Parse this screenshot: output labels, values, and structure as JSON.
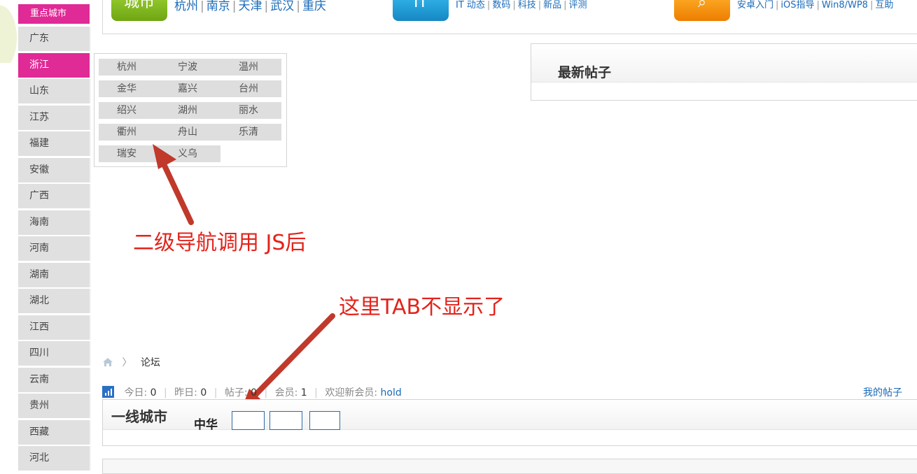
{
  "sidebar": {
    "header": "重点城市",
    "items": [
      {
        "label": "广东",
        "active": false
      },
      {
        "label": "浙江",
        "active": true
      },
      {
        "label": "山东",
        "active": false
      },
      {
        "label": "江苏",
        "active": false
      },
      {
        "label": "福建",
        "active": false
      },
      {
        "label": "安徽",
        "active": false
      },
      {
        "label": "广西",
        "active": false
      },
      {
        "label": "海南",
        "active": false
      },
      {
        "label": "河南",
        "active": false
      },
      {
        "label": "湖南",
        "active": false
      },
      {
        "label": "湖北",
        "active": false
      },
      {
        "label": "江西",
        "active": false
      },
      {
        "label": "四川",
        "active": false
      },
      {
        "label": "云南",
        "active": false
      },
      {
        "label": "贵州",
        "active": false
      },
      {
        "label": "西藏",
        "active": false
      },
      {
        "label": "河北",
        "active": false
      }
    ]
  },
  "topnav": {
    "city_tile": "城市",
    "it_tile": "IT",
    "city_links": [
      "杭州",
      "南京",
      "天津",
      "武汉",
      "重庆"
    ],
    "it_links": [
      "IT 动态",
      "数码",
      "科技",
      "新品",
      "评测"
    ],
    "guide_links": [
      "安卓入门",
      "iOS指导",
      "Win8/WP8",
      "互助"
    ]
  },
  "dropdown": {
    "cities": [
      "杭州",
      "宁波",
      "温州",
      "金华",
      "嘉兴",
      "台州",
      "绍兴",
      "湖州",
      "丽水",
      "衢州",
      "舟山",
      "乐清",
      "瑞安",
      "义乌"
    ]
  },
  "latest": {
    "title": "最新帖子"
  },
  "annotations": {
    "top": "二级导航调用 JS后",
    "bottom": "这里TAB不显示了",
    "color": "#e3231b"
  },
  "breadcrumb": {
    "current": "论坛"
  },
  "stats": {
    "today_label": "今日:",
    "today": "0",
    "yesterday_label": "昨日:",
    "yesterday": "0",
    "posts_label": "帖子:",
    "posts": "0",
    "members_label": "会员:",
    "members": "1",
    "welcome_label": "欢迎新会员:",
    "newest": "hold"
  },
  "myposts": "我的帖子",
  "panel": {
    "title": "一线城市",
    "tab_label": "中华"
  },
  "colors": {
    "accent": "#e02a95",
    "link": "#1a6ab8"
  }
}
